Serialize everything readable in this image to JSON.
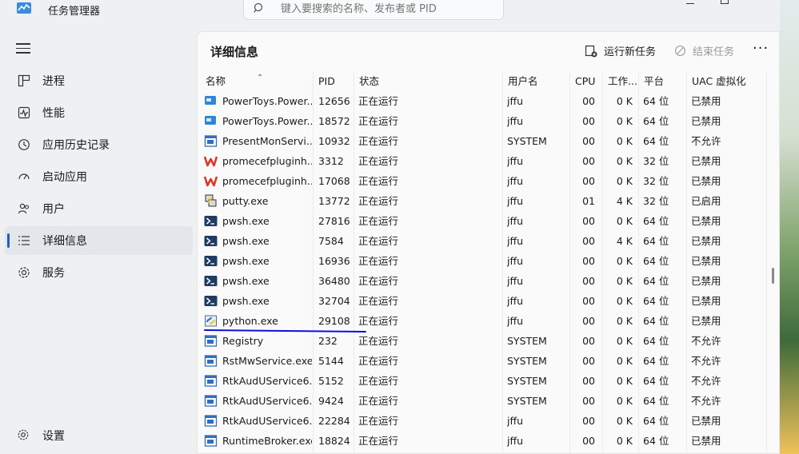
{
  "app": {
    "title": "任务管理器"
  },
  "search": {
    "placeholder": "键入要搜索的名称、发布者或 PID"
  },
  "sidebar": {
    "items": [
      {
        "label": "进程",
        "icon": "processes-icon"
      },
      {
        "label": "性能",
        "icon": "performance-icon"
      },
      {
        "label": "应用历史记录",
        "icon": "history-icon"
      },
      {
        "label": "启动应用",
        "icon": "startup-icon"
      },
      {
        "label": "用户",
        "icon": "users-icon"
      },
      {
        "label": "详细信息",
        "icon": "details-icon",
        "active": true
      },
      {
        "label": "服务",
        "icon": "services-icon"
      }
    ],
    "settings_label": "设置"
  },
  "panel": {
    "title": "详细信息",
    "run_task_label": "运行新任务",
    "end_task_label": "结束任务",
    "more_label": "···"
  },
  "table": {
    "headers": [
      "名称",
      "PID",
      "状态",
      "用户名",
      "CPU",
      "工作...",
      "平台",
      "UAC 虚拟化"
    ],
    "rows": [
      {
        "name": "PowerToys.Power...",
        "pid": "12656",
        "status": "正在运行",
        "user": "jffu",
        "cpu": "00",
        "mem": "0 K",
        "platform": "64 位",
        "uac": "已禁用",
        "icon": "powertoys"
      },
      {
        "name": "PowerToys.Power...",
        "pid": "18572",
        "status": "正在运行",
        "user": "jffu",
        "cpu": "00",
        "mem": "0 K",
        "platform": "64 位",
        "uac": "已禁用",
        "icon": "powertoys"
      },
      {
        "name": "PresentMonServi...",
        "pid": "10932",
        "status": "正在运行",
        "user": "SYSTEM",
        "cpu": "00",
        "mem": "0 K",
        "platform": "64 位",
        "uac": "不允许",
        "icon": "window"
      },
      {
        "name": "promecefpluginh...",
        "pid": "3312",
        "status": "正在运行",
        "user": "jffu",
        "cpu": "00",
        "mem": "0 K",
        "platform": "32 位",
        "uac": "已禁用",
        "icon": "wps"
      },
      {
        "name": "promecefpluginh...",
        "pid": "17068",
        "status": "正在运行",
        "user": "jffu",
        "cpu": "00",
        "mem": "0 K",
        "platform": "32 位",
        "uac": "已禁用",
        "icon": "wps"
      },
      {
        "name": "putty.exe",
        "pid": "13772",
        "status": "正在运行",
        "user": "jffu",
        "cpu": "01",
        "mem": "4 K",
        "platform": "32 位",
        "uac": "已启用",
        "icon": "putty"
      },
      {
        "name": "pwsh.exe",
        "pid": "27816",
        "status": "正在运行",
        "user": "jffu",
        "cpu": "00",
        "mem": "0 K",
        "platform": "64 位",
        "uac": "已禁用",
        "icon": "pwsh"
      },
      {
        "name": "pwsh.exe",
        "pid": "7584",
        "status": "正在运行",
        "user": "jffu",
        "cpu": "00",
        "mem": "4 K",
        "platform": "64 位",
        "uac": "已禁用",
        "icon": "pwsh"
      },
      {
        "name": "pwsh.exe",
        "pid": "16936",
        "status": "正在运行",
        "user": "jffu",
        "cpu": "00",
        "mem": "0 K",
        "platform": "64 位",
        "uac": "已禁用",
        "icon": "pwsh"
      },
      {
        "name": "pwsh.exe",
        "pid": "36480",
        "status": "正在运行",
        "user": "jffu",
        "cpu": "00",
        "mem": "0 K",
        "platform": "64 位",
        "uac": "已禁用",
        "icon": "pwsh"
      },
      {
        "name": "pwsh.exe",
        "pid": "32704",
        "status": "正在运行",
        "user": "jffu",
        "cpu": "00",
        "mem": "0 K",
        "platform": "64 位",
        "uac": "已禁用",
        "icon": "pwsh"
      },
      {
        "name": "python.exe",
        "pid": "29108",
        "status": "正在运行",
        "user": "jffu",
        "cpu": "00",
        "mem": "0 K",
        "platform": "64 位",
        "uac": "已禁用",
        "icon": "python"
      },
      {
        "name": "Registry",
        "pid": "232",
        "status": "正在运行",
        "user": "SYSTEM",
        "cpu": "00",
        "mem": "0 K",
        "platform": "64 位",
        "uac": "不允许",
        "icon": "window"
      },
      {
        "name": "RstMwService.exe",
        "pid": "5144",
        "status": "正在运行",
        "user": "SYSTEM",
        "cpu": "00",
        "mem": "0 K",
        "platform": "64 位",
        "uac": "不允许",
        "icon": "window"
      },
      {
        "name": "RtkAudUService6...",
        "pid": "5152",
        "status": "正在运行",
        "user": "SYSTEM",
        "cpu": "00",
        "mem": "0 K",
        "platform": "64 位",
        "uac": "不允许",
        "icon": "window"
      },
      {
        "name": "RtkAudUService6...",
        "pid": "9424",
        "status": "正在运行",
        "user": "SYSTEM",
        "cpu": "00",
        "mem": "0 K",
        "platform": "64 位",
        "uac": "不允许",
        "icon": "window"
      },
      {
        "name": "RtkAudUService6...",
        "pid": "22284",
        "status": "正在运行",
        "user": "jffu",
        "cpu": "00",
        "mem": "0 K",
        "platform": "64 位",
        "uac": "已禁用",
        "icon": "window"
      },
      {
        "name": "RuntimeBroker.exe",
        "pid": "18824",
        "status": "正在运行",
        "user": "jffu",
        "cpu": "00",
        "mem": "0 K",
        "platform": "64 位",
        "uac": "已禁用",
        "icon": "window"
      }
    ]
  },
  "colors": {
    "accent": "#1f5fbf",
    "annotation": "#1010d8",
    "panel_bg": "#fafafa",
    "window_bg": "#eef0f2"
  }
}
